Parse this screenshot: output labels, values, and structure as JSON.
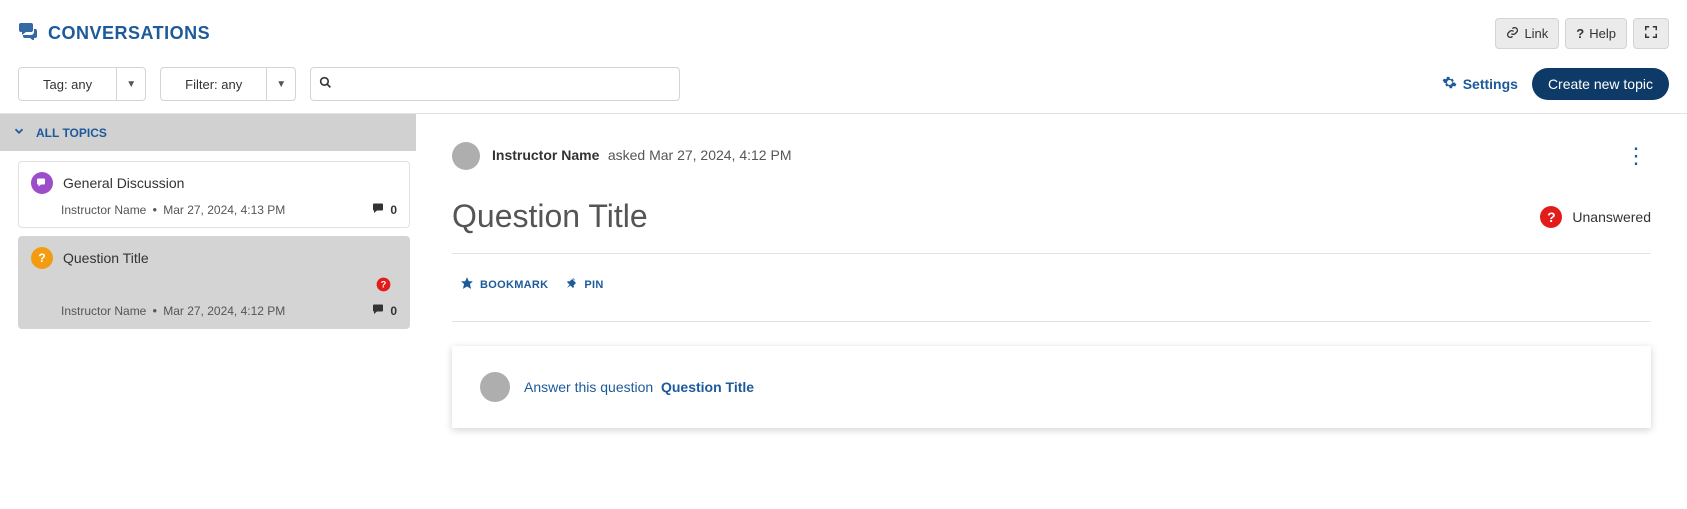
{
  "header": {
    "title": "CONVERSATIONS",
    "link_label": "Link",
    "help_label": "Help"
  },
  "toolbar": {
    "tag_label": "Tag: any",
    "filter_label": "Filter: any",
    "search_placeholder": "",
    "settings_label": "Settings",
    "create_label": "Create new topic"
  },
  "sidebar": {
    "all_topics_label": "ALL TOPICS",
    "items": [
      {
        "icon": "discussion",
        "title": "General Discussion",
        "author": "Instructor Name",
        "time": "Mar 27, 2024, 4:13 PM",
        "comments": "0",
        "alert": false
      },
      {
        "icon": "question",
        "title": "Question Title",
        "author": "Instructor Name",
        "time": "Mar 27, 2024, 4:12 PM",
        "comments": "0",
        "alert": true
      }
    ]
  },
  "post": {
    "author": "Instructor Name",
    "verb": "asked",
    "time": "Mar 27, 2024, 4:12 PM",
    "title": "Question Title",
    "unanswered_label": "Unanswered",
    "bookmark_label": "BOOKMARK",
    "pin_label": "PIN",
    "answer_prompt": "Answer this question",
    "answer_title": "Question Title"
  }
}
